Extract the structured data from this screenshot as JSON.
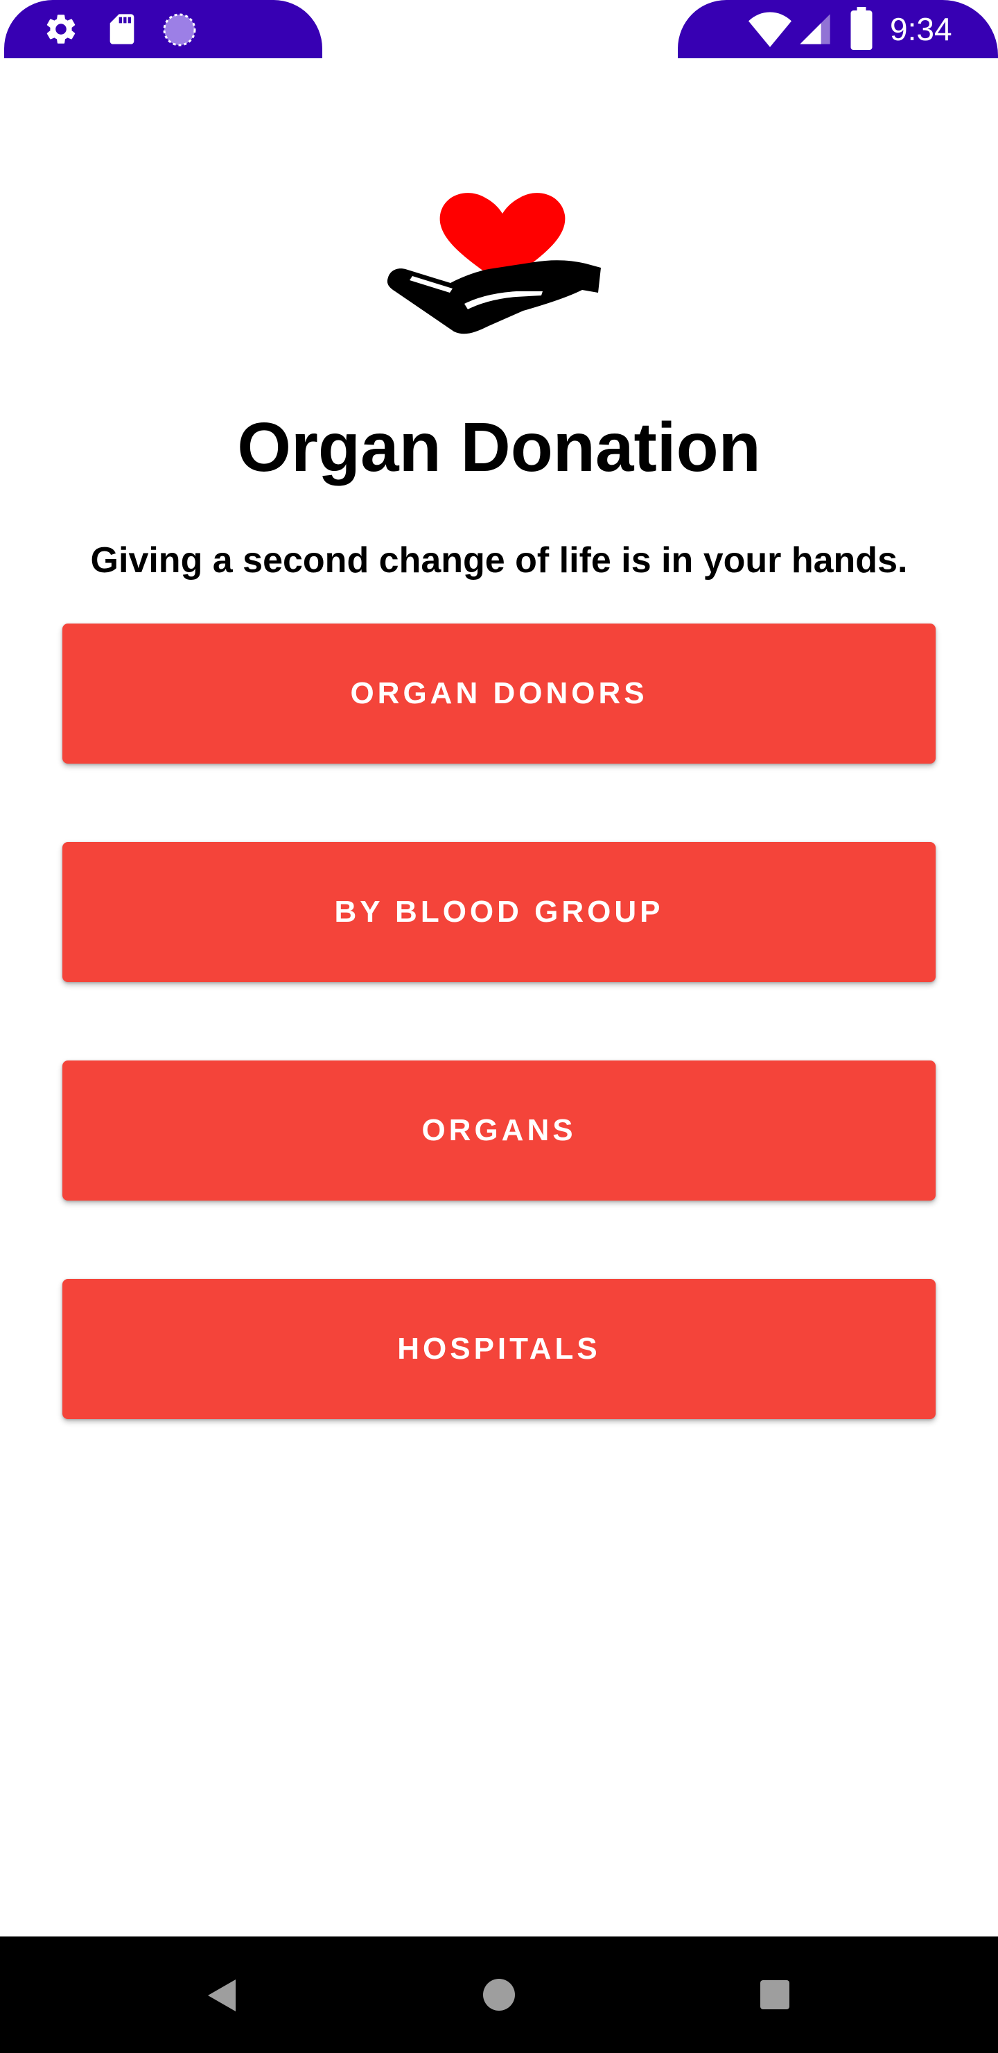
{
  "status_bar": {
    "time": "9:34",
    "left_icons": [
      "settings-icon",
      "sd-card-icon",
      "sync-circle-icon"
    ],
    "right_icons": [
      "wifi-icon",
      "cell-signal-icon",
      "battery-icon"
    ],
    "color": "#3700b3"
  },
  "app": {
    "title": "Organ Donation",
    "subtitle": "Giving a second change of life is in your hands.",
    "logo_icon": "heart-in-hand-icon"
  },
  "menu": {
    "buttons": [
      {
        "label": "ORGAN DONORS"
      },
      {
        "label": "BY BLOOD GROUP"
      },
      {
        "label": "ORGANS"
      },
      {
        "label": "HOSPITALS"
      }
    ],
    "button_color": "#f4443a"
  },
  "nav_bar": {
    "buttons": [
      "back-icon",
      "home-icon",
      "recents-icon"
    ]
  }
}
